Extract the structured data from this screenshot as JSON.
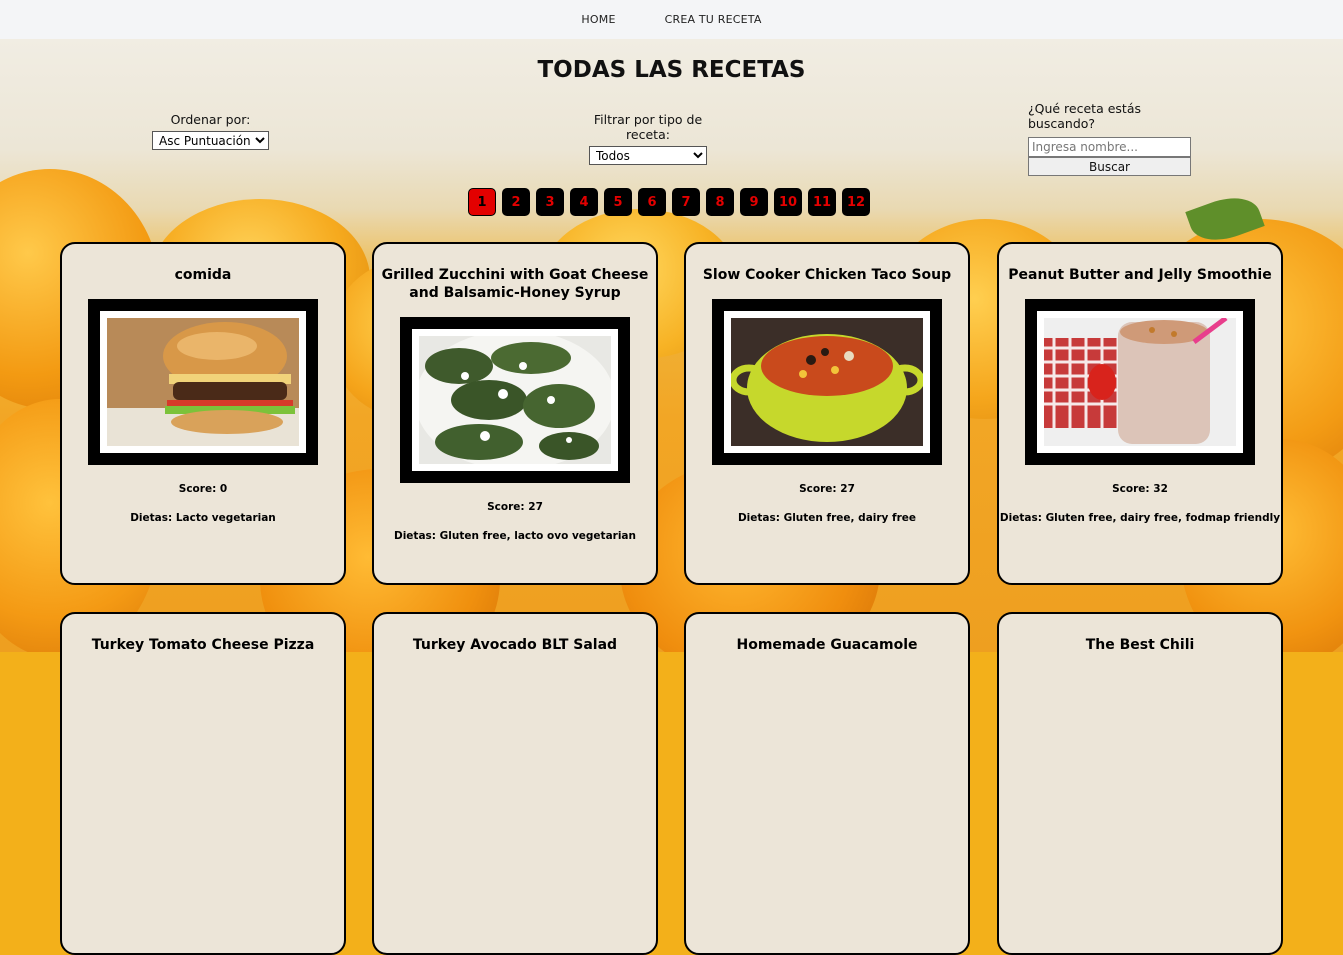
{
  "nav": {
    "home": "HOME",
    "create": "CREA TU RECETA"
  },
  "page_title": "TODAS LAS RECETAS",
  "order": {
    "label": "Ordenar por:",
    "selected": "Asc Puntuación"
  },
  "filter": {
    "label": "Filtrar por tipo de receta:",
    "selected": "Todos"
  },
  "search": {
    "label": "¿Qué receta estás buscando?",
    "placeholder": "Ingresa nombre...",
    "button": "Buscar"
  },
  "pagination": {
    "pages": [
      "1",
      "2",
      "3",
      "4",
      "5",
      "6",
      "7",
      "8",
      "9",
      "10",
      "11",
      "12"
    ],
    "current": "1"
  },
  "recipes": [
    {
      "title": "comida",
      "image": "burger-photo",
      "score": "Score: 0",
      "diets": "Dietas: Lacto vegetarian"
    },
    {
      "title": "Grilled Zucchini with Goat Cheese and Balsamic-Honey Syrup",
      "image": "zucchini-photo",
      "score": "Score: 27",
      "diets": "Dietas: Gluten free, lacto ovo vegetarian"
    },
    {
      "title": "Slow Cooker Chicken Taco Soup",
      "image": "soup-photo",
      "score": "Score: 27",
      "diets": "Dietas: Gluten free, dairy free"
    },
    {
      "title": "Peanut Butter and Jelly Smoothie",
      "image": "smoothie-photo",
      "score": "Score: 32",
      "diets": "Dietas: Gluten free, dairy free, fodmap friendly"
    },
    {
      "title": "Turkey Tomato Cheese Pizza"
    },
    {
      "title": "Turkey Avocado BLT Salad"
    },
    {
      "title": "Homemade Guacamole"
    },
    {
      "title": "The Best Chili"
    }
  ],
  "colors": {
    "accent": "#e30000",
    "card_bg": "#ece5d8",
    "nav_bg": "#f4f5f7"
  }
}
